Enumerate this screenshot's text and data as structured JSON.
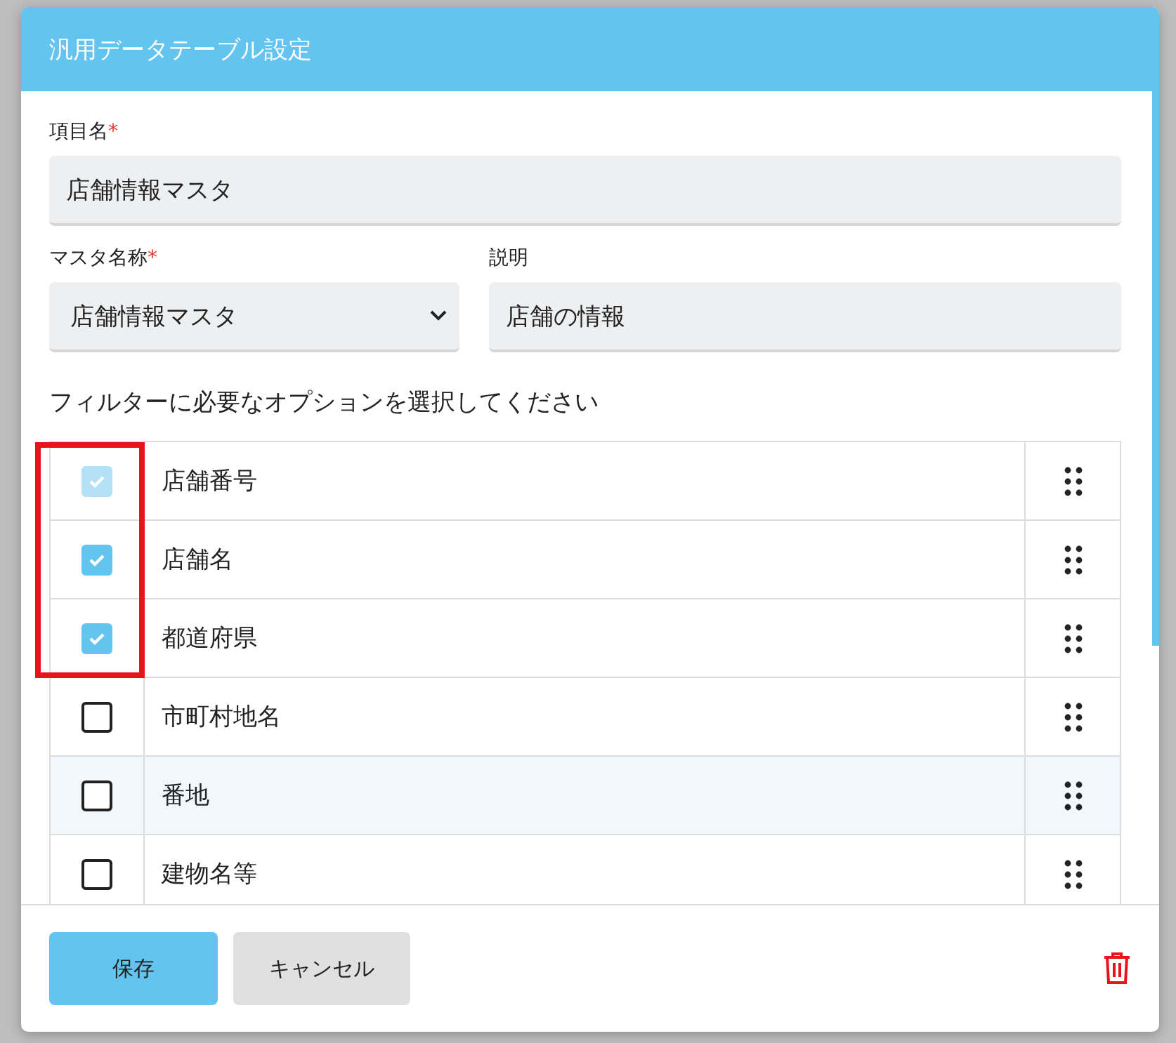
{
  "dialog": {
    "title": "汎用データテーブル設定"
  },
  "item_name": {
    "label": "項目名",
    "required_mark": "*",
    "value": "店舗情報マスタ"
  },
  "master_name": {
    "label": "マスタ名称",
    "required_mark": "*",
    "value": "店舗情報マスタ"
  },
  "description": {
    "label": "説明",
    "value": "店舗の情報"
  },
  "filter_prompt": "フィルターに必要なオプションを選択してください",
  "options": [
    {
      "name": "店舗番号",
      "checked": true,
      "disabled": true,
      "selected": false
    },
    {
      "name": "店舗名",
      "checked": true,
      "disabled": false,
      "selected": false
    },
    {
      "name": "都道府県",
      "checked": true,
      "disabled": false,
      "selected": false
    },
    {
      "name": "市町村地名",
      "checked": false,
      "disabled": false,
      "selected": false
    },
    {
      "name": "番地",
      "checked": false,
      "disabled": false,
      "selected": true
    },
    {
      "name": "建物名等",
      "checked": false,
      "disabled": false,
      "selected": false
    }
  ],
  "buttons": [
    {
      "label": "保存",
      "kind": "primary"
    },
    {
      "label": "キャンセル",
      "kind": "secondary"
    }
  ]
}
